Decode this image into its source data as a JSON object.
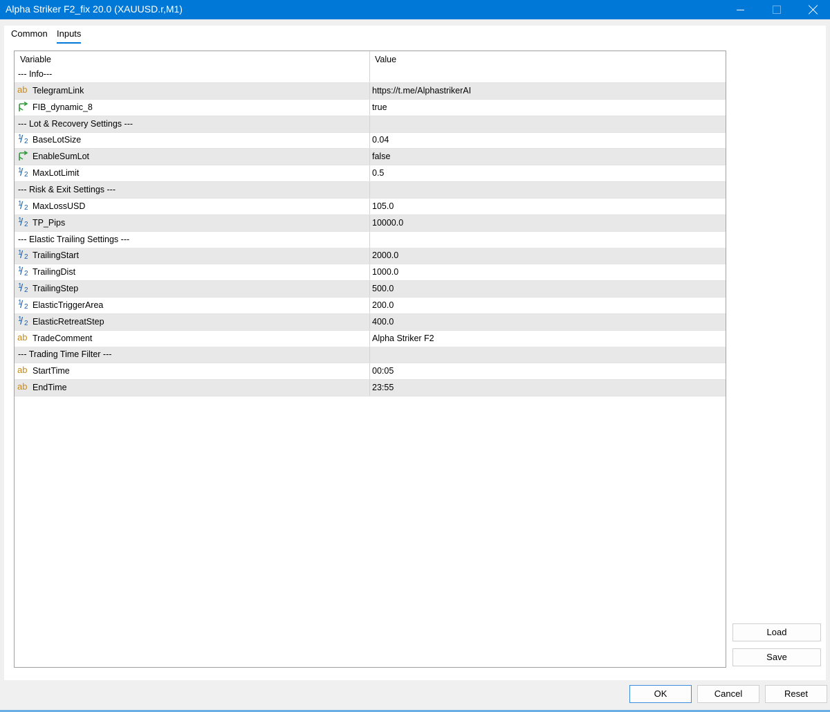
{
  "window": {
    "title": "Alpha Striker F2_fix 20.0 (XAUUSD.r,M1)"
  },
  "tabs": [
    {
      "label": "Common",
      "active": false
    },
    {
      "label": "Inputs",
      "active": true
    }
  ],
  "grid": {
    "headers": {
      "variable": "Variable",
      "value": "Value"
    },
    "rows": [
      {
        "type": "section",
        "variable": "--- Info---",
        "value": ""
      },
      {
        "type": "string",
        "icon": "ab-string-icon",
        "variable": "TelegramLink",
        "value": "https://t.me/AlphastrikerAI"
      },
      {
        "type": "bool",
        "icon": "bool-arrow-icon",
        "variable": "FIB_dynamic_8",
        "value": "true"
      },
      {
        "type": "section",
        "variable": "--- Lot & Recovery Settings ---",
        "value": ""
      },
      {
        "type": "double",
        "icon": "half-fraction-icon",
        "variable": "BaseLotSize",
        "value": "0.04"
      },
      {
        "type": "bool",
        "icon": "bool-arrow-icon",
        "variable": "EnableSumLot",
        "value": "false"
      },
      {
        "type": "double",
        "icon": "half-fraction-icon",
        "variable": "MaxLotLimit",
        "value": "0.5"
      },
      {
        "type": "section",
        "variable": "--- Risk & Exit Settings ---",
        "value": ""
      },
      {
        "type": "double",
        "icon": "half-fraction-icon",
        "variable": "MaxLossUSD",
        "value": "105.0"
      },
      {
        "type": "double",
        "icon": "half-fraction-icon",
        "variable": "TP_Pips",
        "value": "10000.0"
      },
      {
        "type": "section",
        "variable": "--- Elastic Trailing Settings ---",
        "value": ""
      },
      {
        "type": "double",
        "icon": "half-fraction-icon",
        "variable": "TrailingStart",
        "value": "2000.0"
      },
      {
        "type": "double",
        "icon": "half-fraction-icon",
        "variable": "TrailingDist",
        "value": "1000.0"
      },
      {
        "type": "double",
        "icon": "half-fraction-icon",
        "variable": "TrailingStep",
        "value": "500.0"
      },
      {
        "type": "double",
        "icon": "half-fraction-icon",
        "variable": "ElasticTriggerArea",
        "value": "200.0"
      },
      {
        "type": "double",
        "icon": "half-fraction-icon",
        "variable": "ElasticRetreatStep",
        "value": "400.0"
      },
      {
        "type": "string",
        "icon": "ab-string-icon",
        "variable": "TradeComment",
        "value": "Alpha Striker F2"
      },
      {
        "type": "section",
        "variable": "--- Trading Time Filter ---",
        "value": ""
      },
      {
        "type": "string",
        "icon": "ab-string-icon",
        "variable": "StartTime",
        "value": "00:05"
      },
      {
        "type": "string",
        "icon": "ab-string-icon",
        "variable": "EndTime",
        "value": "23:55"
      }
    ]
  },
  "side_buttons": {
    "load": "Load",
    "save": "Save"
  },
  "footer_buttons": {
    "ok": "OK",
    "cancel": "Cancel",
    "reset": "Reset"
  },
  "colors": {
    "titlebar": "#0078d7",
    "string_icon": "#c88a1c",
    "bool_icon": "#2e9a3a",
    "double_icon": "#1a5fa8",
    "row_alt": "#e8e8e8"
  }
}
